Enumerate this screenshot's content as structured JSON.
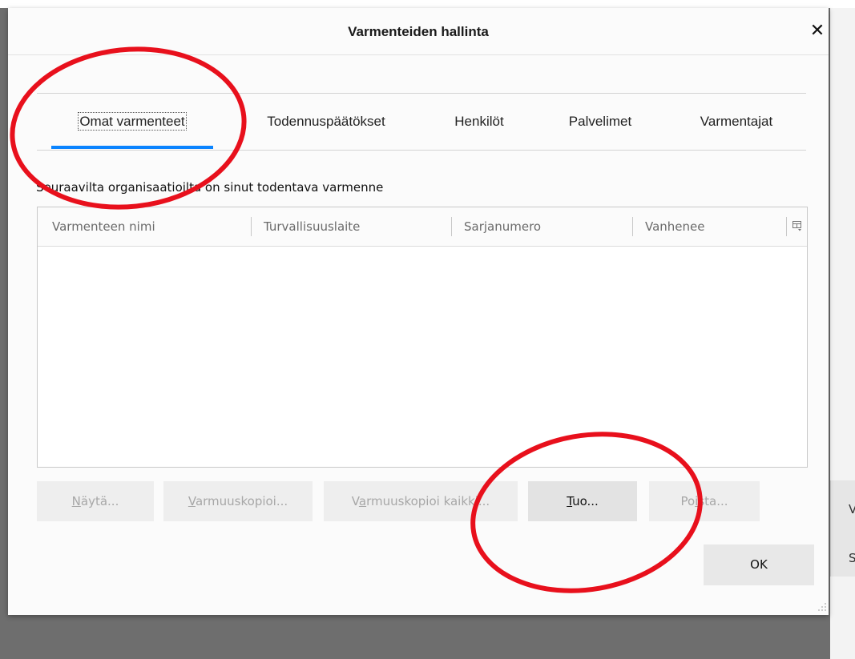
{
  "dialog": {
    "title": "Varmenteiden hallinta",
    "close_glyph": "✕"
  },
  "tabs": [
    {
      "label": "Omat varmenteet",
      "active": true
    },
    {
      "label": "Todennuspäätökset",
      "active": false
    },
    {
      "label": "Henkilöt",
      "active": false
    },
    {
      "label": "Palvelimet",
      "active": false
    },
    {
      "label": "Varmentajat",
      "active": false
    }
  ],
  "description": "Seuraavilta organisaatioilta on sinut todentava varmenne",
  "table": {
    "columns": [
      "Varmenteen nimi",
      "Turvallisuuslaite",
      "Sarjanumero",
      "Vanhenee"
    ],
    "rows": [],
    "column_picker_icon": "column-picker-icon"
  },
  "buttons": {
    "view": {
      "first": "N",
      "rest": "äytä...",
      "enabled": false
    },
    "backup": {
      "first": "V",
      "rest": "armuuskopioi...",
      "enabled": false
    },
    "backup_all": {
      "pre": "V",
      "mid": "a",
      "rest": "rmuuskopioi kaikki...",
      "enabled": false
    },
    "import": {
      "first": "T",
      "rest": "uo...",
      "enabled": true
    },
    "delete": {
      "pre": "Po",
      "mid": "i",
      "rest": "sta...",
      "enabled": false
    },
    "ok": "OK"
  },
  "background_side_letters": [
    "V",
    "S"
  ],
  "colors": {
    "accent": "#0a84ff",
    "annotation": "#e8101c"
  }
}
